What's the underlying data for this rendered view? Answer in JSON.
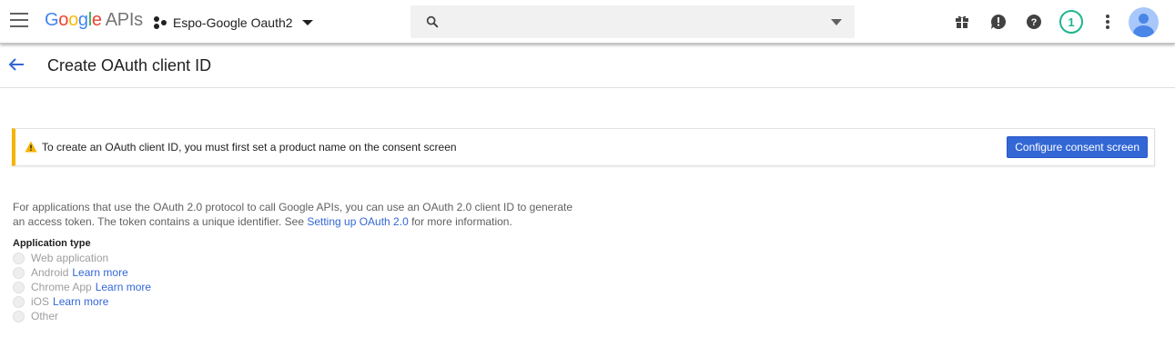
{
  "topbar": {
    "logo_letters": [
      "G",
      "o",
      "o",
      "g",
      "l",
      "e"
    ],
    "logo_suffix": "APIs",
    "project_name": "Espo-Google Oauth2",
    "search_placeholder": "",
    "notification_count": "1",
    "icons": [
      "menu-icon",
      "gift-icon",
      "feedback-icon",
      "help-icon",
      "more-vert-icon",
      "account-icon"
    ]
  },
  "page": {
    "title": "Create OAuth client ID"
  },
  "banner": {
    "message": "To create an OAuth client ID, you must first set a product name on the consent screen",
    "button_label": "Configure consent screen",
    "accent_color": "#f4b400"
  },
  "description": {
    "text_before_link": "For applications that use the OAuth 2.0 protocol to call Google APIs, you can use an OAuth 2.0 client ID to generate an access token. The token contains a unique identifier. See ",
    "link_text": "Setting up OAuth 2.0",
    "text_after_link": " for more information."
  },
  "application_type": {
    "label": "Application type",
    "options": [
      {
        "label": "Web application",
        "link": ""
      },
      {
        "label": "Android",
        "link": "Learn more"
      },
      {
        "label": "Chrome App",
        "link": "Learn more"
      },
      {
        "label": "iOS",
        "link": "Learn more"
      },
      {
        "label": "Other",
        "link": ""
      }
    ]
  },
  "colors": {
    "link": "#3367d6",
    "primary_button": "#3367d6",
    "badge": "#1fb58f"
  }
}
